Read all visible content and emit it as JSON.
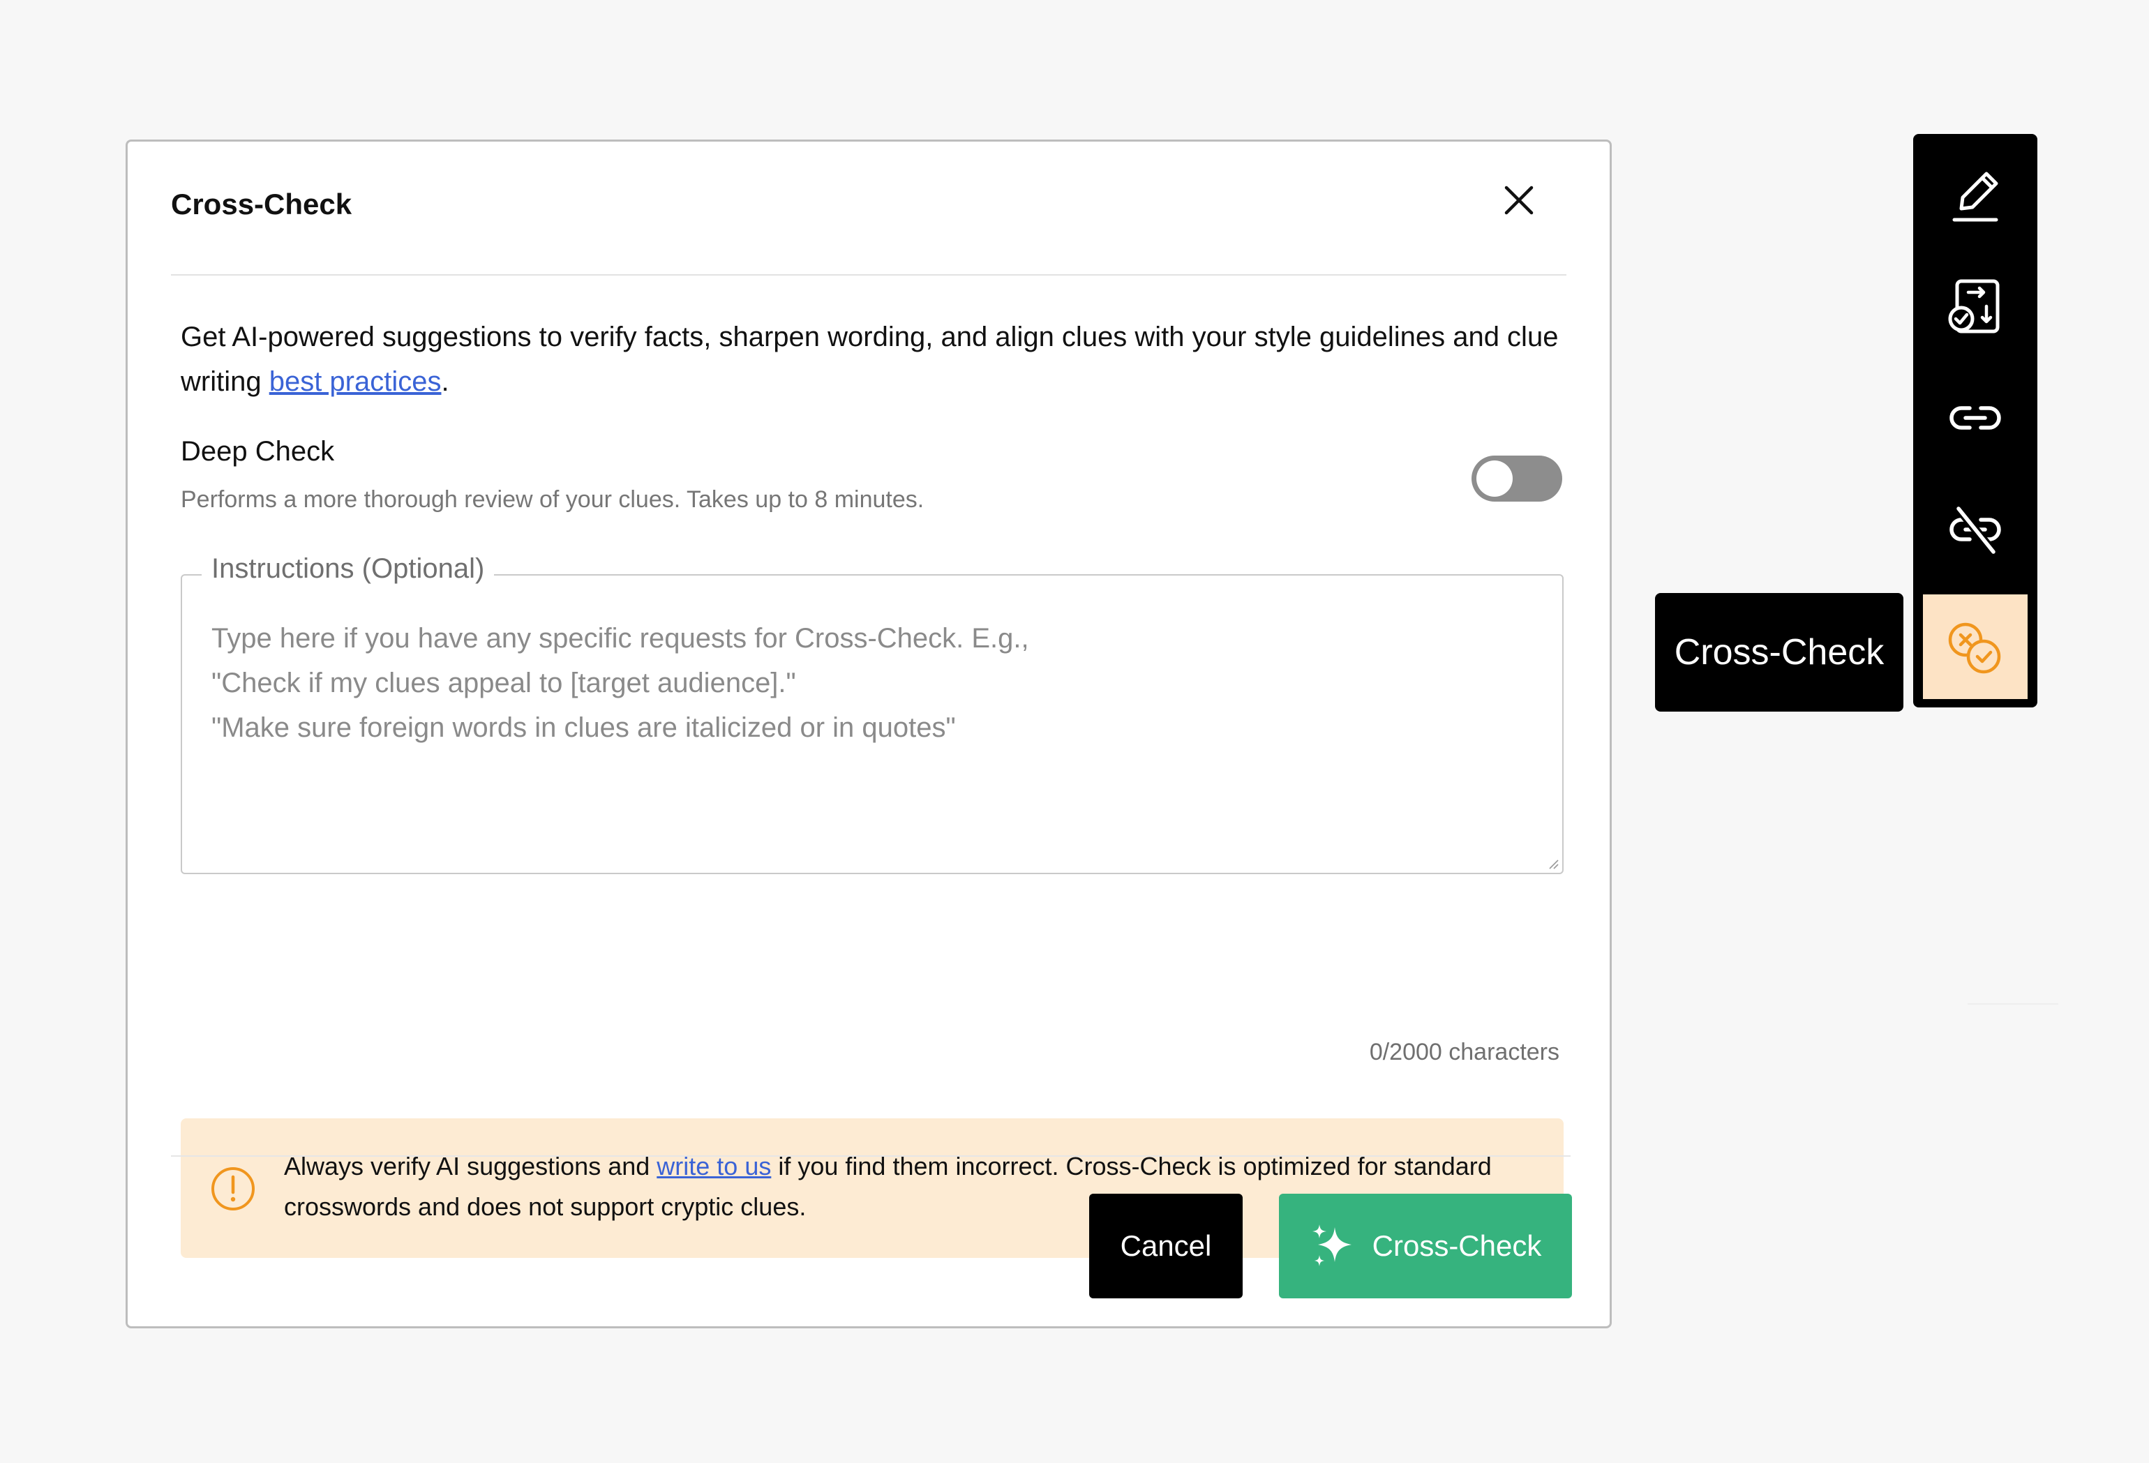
{
  "modal": {
    "title": "Cross-Check",
    "description_before": "Get AI-powered suggestions to verify facts, sharpen wording, and align clues with your style guidelines and clue writing ",
    "description_link": "best practices",
    "description_after": ".",
    "deep_check": {
      "label": "Deep Check",
      "description": "Performs a more thorough review of your clues. Takes up to 8 minutes.",
      "enabled": false
    },
    "instructions": {
      "legend": "Instructions (Optional)",
      "value": "",
      "placeholder_lines": [
        "Type here if you have any specific requests for Cross-Check. E.g.,",
        "\"Check if my clues appeal to [target audience].\"",
        "\"Make sure foreign words in clues are italicized or in quotes\""
      ],
      "char_count": "0/2000 characters"
    },
    "warning": {
      "text_before": "Always verify AI suggestions and ",
      "link": "write to us",
      "text_after": " if you find them incorrect. Cross-Check is optimized for standard crosswords and does not support cryptic clues."
    },
    "buttons": {
      "cancel": "Cancel",
      "submit": "Cross-Check"
    }
  },
  "toolbar": {
    "items": [
      {
        "name": "pencil-icon"
      },
      {
        "name": "clue-check-icon"
      },
      {
        "name": "link-icon"
      },
      {
        "name": "unlink-icon"
      },
      {
        "name": "cross-check-icon",
        "active": true
      }
    ],
    "tooltip": "Cross-Check"
  },
  "colors": {
    "accent_green": "#36b37e",
    "warning_bg": "#fdebd3",
    "warning_orange": "#f0961e",
    "active_tool_bg": "#fde3c5",
    "link_blue": "#3a63d6"
  }
}
